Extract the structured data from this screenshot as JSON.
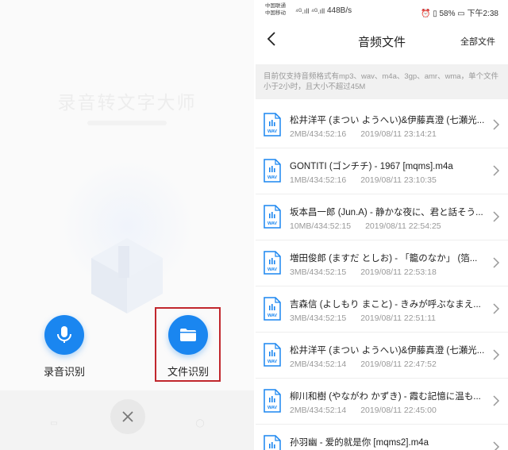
{
  "left": {
    "background_title": "录音转文字大师",
    "actions": [
      {
        "label": "录音识别",
        "icon": "microphone-icon"
      },
      {
        "label": "文件识别",
        "icon": "folder-icon"
      }
    ],
    "close_icon": "close-icon",
    "accent": "#1a86f0",
    "highlight_color": "#c1272d"
  },
  "right": {
    "status": {
      "carrier1": "中国联通",
      "carrier2": "中国移动",
      "signal": "⁴ᴳ.ıll ⁴ᴳ.ıll",
      "speed": "448B/s",
      "battery": "58%",
      "time": "下午2:38"
    },
    "nav": {
      "title": "音频文件",
      "right_action": "全部文件"
    },
    "notice": "目前仅支持音频格式有mp3、wav、m4a、3gp、amr、wma，单个文件小于2小时，且大小不超过45M",
    "files": [
      {
        "name": "松井洋平 (まつい ようへい)&伊藤真澄 (七瀬光...",
        "size": "2MB/434:52:16",
        "date": "2019/08/11 23:14:21"
      },
      {
        "name": "GONTITI (ゴンチチ) - 1967 [mqms].m4a",
        "size": "1MB/434:52:16",
        "date": "2019/08/11 23:10:35"
      },
      {
        "name": "坂本昌一郎 (Jun.A) - 静かな夜に、君と話そう...",
        "size": "10MB/434:52:15",
        "date": "2019/08/11 22:54:25"
      },
      {
        "name": "増田俊郎 (ますだ としお) - 「籠のなか」 (箔...",
        "size": "3MB/434:52:15",
        "date": "2019/08/11 22:53:18"
      },
      {
        "name": "吉森信 (よしもり まこと) - きみが呼ぶなまえ...",
        "size": "3MB/434:52:15",
        "date": "2019/08/11 22:51:11"
      },
      {
        "name": "松井洋平 (まつい ようへい)&伊藤真澄 (七瀬光...",
        "size": "2MB/434:52:14",
        "date": "2019/08/11 22:47:52"
      },
      {
        "name": "柳川和樹 (やながわ かずき) - 霞む記憶に温も...",
        "size": "2MB/434:52:14",
        "date": "2019/08/11 22:45:00"
      },
      {
        "name": "孙羽幽 - 爱的就是你 [mqms2].m4a",
        "size": "",
        "date": ""
      }
    ],
    "file_icon": "wav-file-icon"
  }
}
